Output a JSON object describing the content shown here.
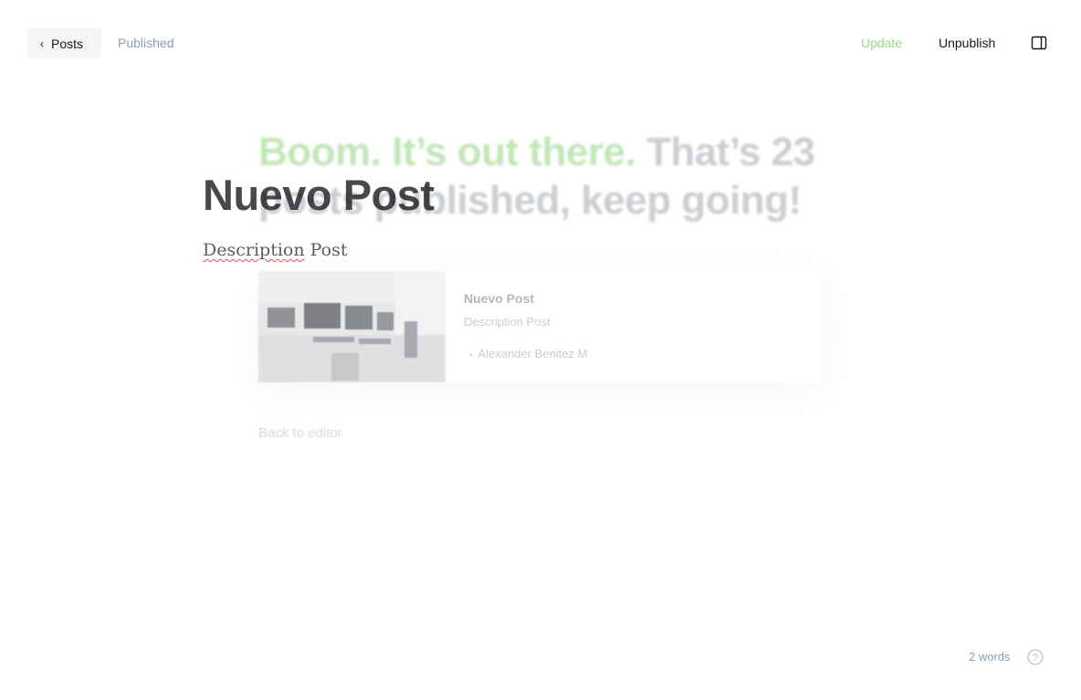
{
  "header": {
    "back_label": "Posts",
    "status": "Published",
    "update_label": "Update",
    "unpublish_label": "Unpublish"
  },
  "overlay": {
    "headline_green": "Boom. It’s out there.",
    "headline_gray": "That’s 23 posts published, keep going!",
    "preview": {
      "title": "Nuevo Post",
      "description": "Description Post",
      "author": "Alexander Benitez M"
    },
    "back_to_editor": "Back to editor"
  },
  "editor": {
    "title": "Nuevo Post",
    "description_word1": "Description",
    "description_word2": " Post"
  },
  "footer": {
    "word_count": "2 words"
  },
  "icons": {
    "back": "chevron-left-icon",
    "sidebar": "sidebar-toggle-icon",
    "help": "help-circle-icon"
  },
  "colors": {
    "accent_green": "#94d985",
    "muted": "#8e9cac"
  }
}
